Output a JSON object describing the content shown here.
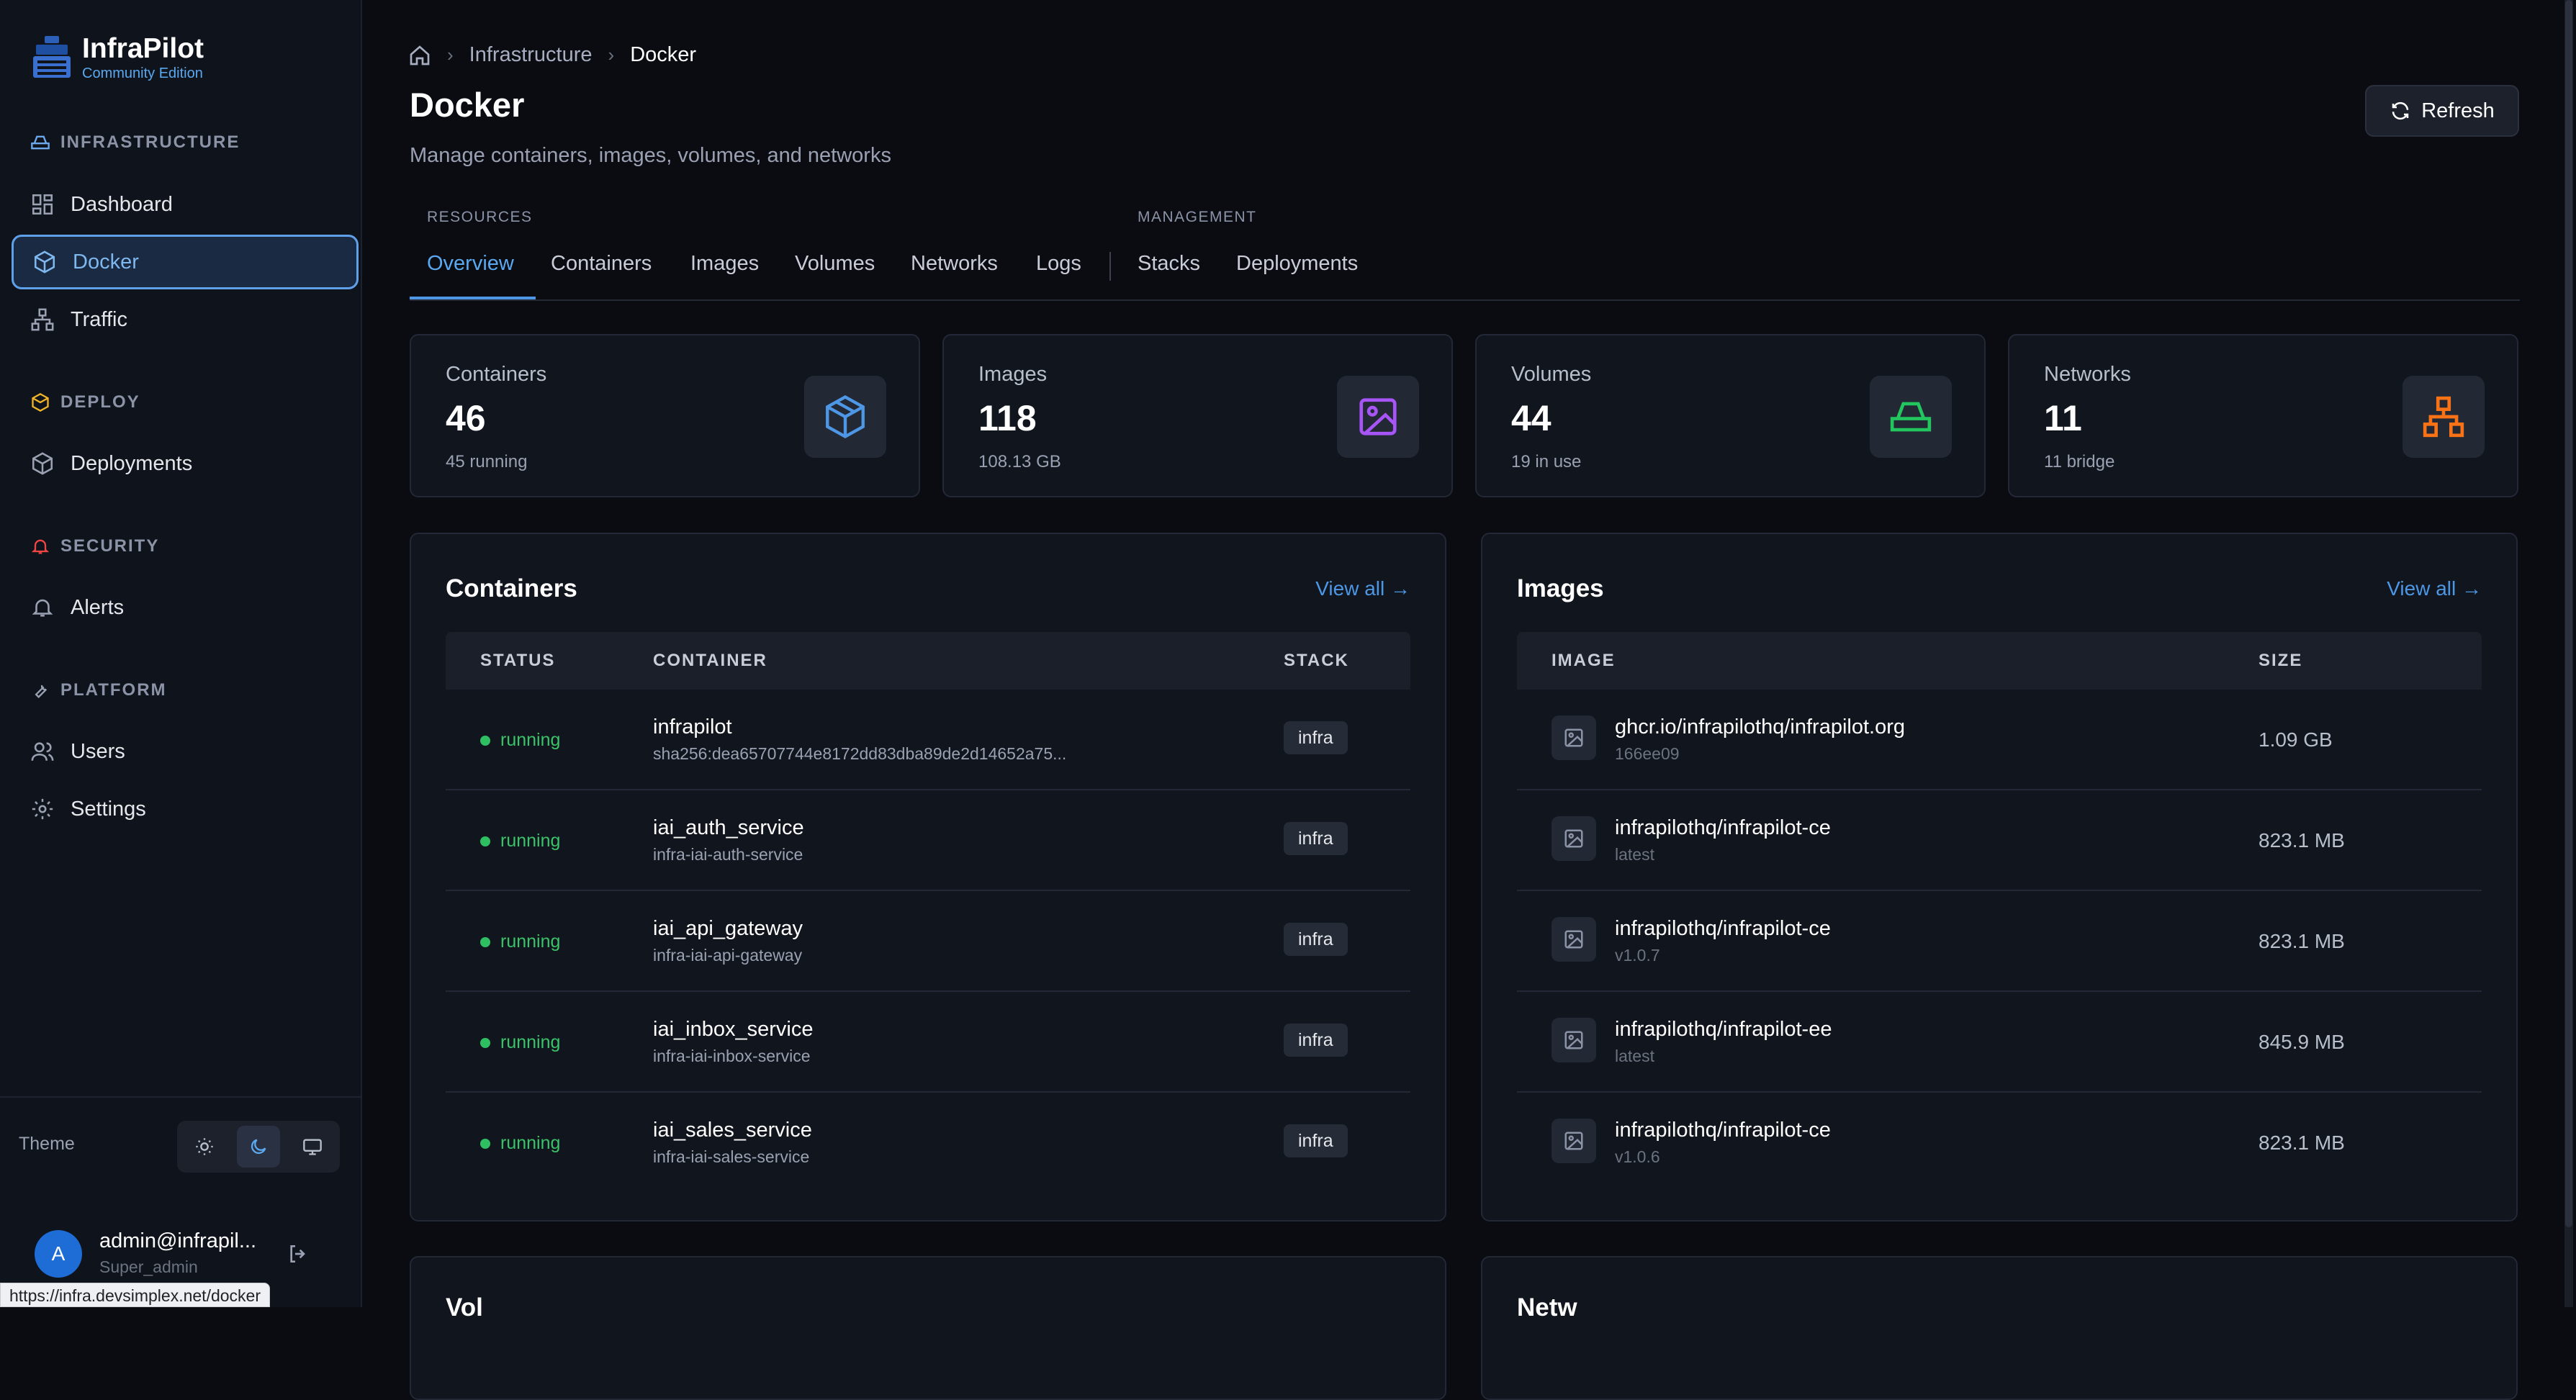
{
  "app": {
    "name": "InfraPilot",
    "edition": "Community Edition"
  },
  "sidebar": {
    "sections": [
      {
        "label": "INFRASTRUCTURE",
        "items": [
          {
            "label": "Dashboard"
          },
          {
            "label": "Docker",
            "active": true
          },
          {
            "label": "Traffic"
          }
        ]
      },
      {
        "label": "DEPLOY",
        "items": [
          {
            "label": "Deployments"
          }
        ]
      },
      {
        "label": "SECURITY",
        "items": [
          {
            "label": "Alerts"
          }
        ]
      },
      {
        "label": "PLATFORM",
        "items": [
          {
            "label": "Users"
          },
          {
            "label": "Settings"
          }
        ]
      }
    ],
    "theme_label": "Theme",
    "theme_selected": "dark",
    "user": {
      "initial": "A",
      "name": "admin@infrapil...",
      "role": "Super_admin"
    }
  },
  "status_url": "https://infra.devsimplex.net/docker",
  "breadcrumb": {
    "items": [
      "Infrastructure"
    ],
    "current": "Docker"
  },
  "page": {
    "title": "Docker",
    "subtitle": "Manage containers, images, volumes, and networks",
    "refresh_label": "Refresh"
  },
  "tabs": {
    "resources_label": "RESOURCES",
    "management_label": "MANAGEMENT",
    "items": [
      "Overview",
      "Containers",
      "Images",
      "Volumes",
      "Networks",
      "Logs",
      "Stacks",
      "Deployments"
    ],
    "active": "Overview"
  },
  "stats": [
    {
      "label": "Containers",
      "value": "46",
      "sub": "45 running",
      "icon": "box-icon",
      "color": "#4d97e6"
    },
    {
      "label": "Images",
      "value": "118",
      "sub": "108.13 GB",
      "icon": "image-icon",
      "color": "#a855f7"
    },
    {
      "label": "Volumes",
      "value": "44",
      "sub": "19 in use",
      "icon": "hard-drive-icon",
      "color": "#22c55e"
    },
    {
      "label": "Networks",
      "value": "11",
      "sub": "11 bridge",
      "icon": "network-icon",
      "color": "#f97316"
    }
  ],
  "containers": {
    "title": "Containers",
    "view_all": "View all →",
    "columns": [
      "STATUS",
      "CONTAINER",
      "STACK"
    ],
    "rows": [
      {
        "status": "running",
        "name": "infrapilot",
        "sub": "sha256:dea65707744e8172dd83dba89de2d14652a75...",
        "stack": "infra"
      },
      {
        "status": "running",
        "name": "iai_auth_service",
        "sub": "infra-iai-auth-service",
        "stack": "infra"
      },
      {
        "status": "running",
        "name": "iai_api_gateway",
        "sub": "infra-iai-api-gateway",
        "stack": "infra"
      },
      {
        "status": "running",
        "name": "iai_inbox_service",
        "sub": "infra-iai-inbox-service",
        "stack": "infra"
      },
      {
        "status": "running",
        "name": "iai_sales_service",
        "sub": "infra-iai-sales-service",
        "stack": "infra"
      }
    ]
  },
  "images": {
    "title": "Images",
    "view_all": "View all →",
    "columns": [
      "IMAGE",
      "SIZE"
    ],
    "rows": [
      {
        "name": "ghcr.io/infrapilothq/infrapilot.org",
        "tag": "166ee09",
        "size": "1.09 GB"
      },
      {
        "name": "infrapilothq/infrapilot-ce",
        "tag": "latest",
        "size": "823.1 MB"
      },
      {
        "name": "infrapilothq/infrapilot-ce",
        "tag": "v1.0.7",
        "size": "823.1 MB"
      },
      {
        "name": "infrapilothq/infrapilot-ee",
        "tag": "latest",
        "size": "845.9 MB"
      },
      {
        "name": "infrapilothq/infrapilot-ce",
        "tag": "v1.0.6",
        "size": "823.1 MB"
      }
    ]
  },
  "below": {
    "left_title": "Vol",
    "right_title": "Netw"
  }
}
